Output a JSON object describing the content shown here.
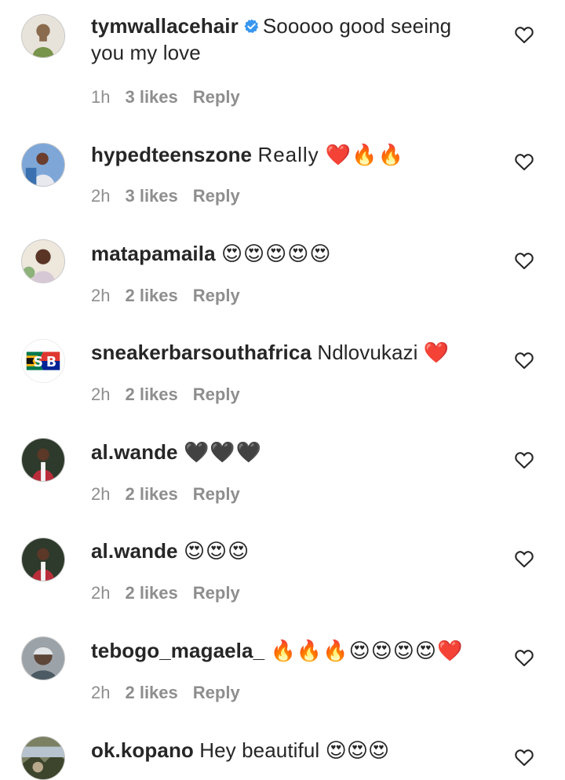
{
  "colors": {
    "text": "#262626",
    "secondary_text": "#8e8e8e",
    "verified_blue": "#3897f0",
    "background": "#ffffff"
  },
  "comments": [
    {
      "username": "tymwallacehair",
      "verified": true,
      "text": "Sooooo good seeing you my love",
      "time": "1h",
      "likes": "3 likes",
      "reply": "Reply",
      "avatar_icon": "avatar-photo-man-green-shirt",
      "like_icon": "heart-outline-icon"
    },
    {
      "username": "hypedteenszone",
      "verified": false,
      "text": "Really ❤️🔥🔥",
      "time": "2h",
      "likes": "3 likes",
      "reply": "Reply",
      "avatar_icon": "avatar-photo-woman-blue",
      "like_icon": "heart-outline-icon"
    },
    {
      "username": "matapamaila",
      "verified": false,
      "text": "😍😍😍😍😍",
      "time": "2h",
      "likes": "2 likes",
      "reply": "Reply",
      "avatar_icon": "avatar-photo-woman-light",
      "like_icon": "heart-outline-icon"
    },
    {
      "username": "sneakerbarsouthafrica",
      "verified": false,
      "text": "Ndlovukazi ❤️",
      "time": "2h",
      "likes": "2 likes",
      "reply": "Reply",
      "avatar_icon": "avatar-logo-sb-flag",
      "like_icon": "heart-outline-icon"
    },
    {
      "username": "al.wande",
      "verified": false,
      "text": "🖤🖤🖤",
      "time": "2h",
      "likes": "2 likes",
      "reply": "Reply",
      "avatar_icon": "avatar-photo-boy-red",
      "like_icon": "heart-outline-icon"
    },
    {
      "username": "al.wande",
      "verified": false,
      "text": "😍😍😍",
      "time": "2h",
      "likes": "2 likes",
      "reply": "Reply",
      "avatar_icon": "avatar-photo-boy-red",
      "like_icon": "heart-outline-icon"
    },
    {
      "username": "tebogo_magaela_",
      "verified": false,
      "text": "🔥🔥🔥😍😍😍😍❤️",
      "time": "2h",
      "likes": "2 likes",
      "reply": "Reply",
      "avatar_icon": "avatar-photo-man-outdoor",
      "like_icon": "heart-outline-icon"
    },
    {
      "username": "ok.kopano",
      "verified": false,
      "text": "Hey beautiful 😍😍😍",
      "time": "",
      "likes": "",
      "reply": "",
      "avatar_icon": "avatar-photo-landscape",
      "like_icon": "heart-outline-icon"
    }
  ]
}
